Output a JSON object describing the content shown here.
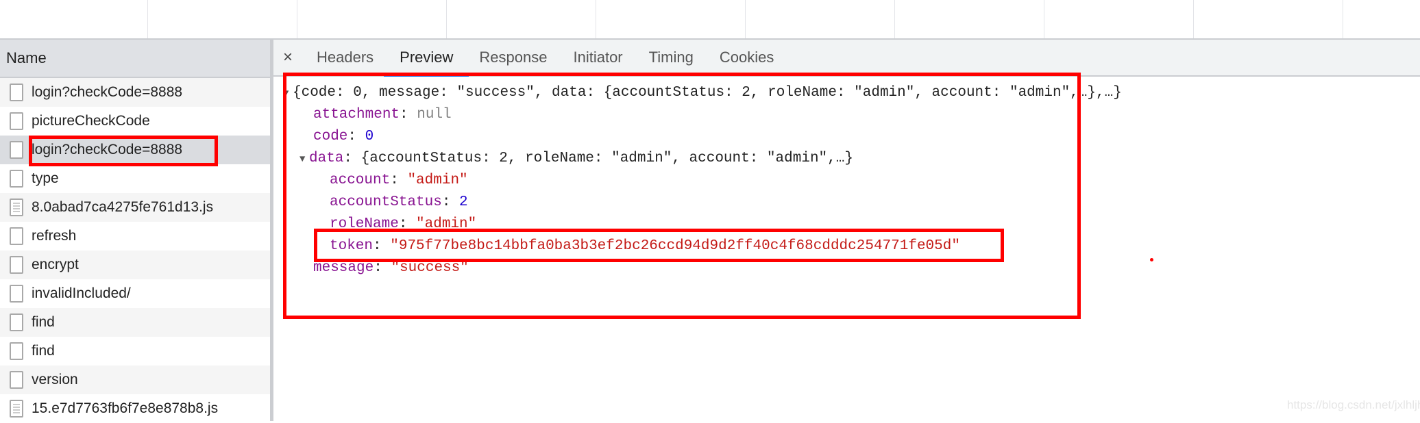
{
  "network_list": {
    "header": "Name",
    "items": [
      {
        "name": "login?checkCode=8888",
        "type": "doc"
      },
      {
        "name": "pictureCheckCode",
        "type": "doc"
      },
      {
        "name": "login?checkCode=8888",
        "type": "doc",
        "selected": true
      },
      {
        "name": "type",
        "type": "doc"
      },
      {
        "name": "8.0abad7ca4275fe761d13.js",
        "type": "js"
      },
      {
        "name": "refresh",
        "type": "doc"
      },
      {
        "name": "encrypt",
        "type": "doc"
      },
      {
        "name": "invalidIncluded/",
        "type": "doc"
      },
      {
        "name": "find",
        "type": "doc"
      },
      {
        "name": "find",
        "type": "doc"
      },
      {
        "name": "version",
        "type": "doc"
      },
      {
        "name": "15.e7d7763fb6f7e8e878b8.js",
        "type": "js"
      }
    ]
  },
  "tabs": {
    "close": "×",
    "items": [
      "Headers",
      "Preview",
      "Response",
      "Initiator",
      "Timing",
      "Cookies"
    ],
    "active": "Preview"
  },
  "preview": {
    "summary": "{code: 0, message: \"success\", data: {accountStatus: 2, roleName: \"admin\", account: \"admin\",…},…}",
    "attachment_key": "attachment",
    "attachment_val": "null",
    "code_key": "code",
    "code_val": "0",
    "data_key": "data",
    "data_summary": "{accountStatus: 2, roleName: \"admin\", account: \"admin\",…}",
    "account_key": "account",
    "account_val": "\"admin\"",
    "accountStatus_key": "accountStatus",
    "accountStatus_val": "2",
    "roleName_key": "roleName",
    "roleName_val": "\"admin\"",
    "token_key": "token",
    "token_val": "\"975f77be8bc14bbfa0ba3b3ef2bc26ccd94d9d2ff40c4f68cdddc254771fe05d\"",
    "message_key": "message",
    "message_val": "\"success\""
  },
  "watermark": "https://blog.csdn.net/jxlhljh",
  "colors": {
    "highlight": "#ff0000",
    "accent": "#1a73e8",
    "key": "#881391",
    "string": "#c41a16",
    "number": "#1c00cf"
  }
}
